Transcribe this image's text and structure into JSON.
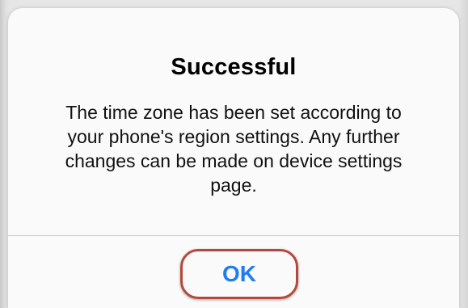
{
  "alert": {
    "title": "Successful",
    "message": "The time zone has been set according to your phone's region settings. Any further changes can be made on device settings page.",
    "ok_label": "OK"
  },
  "colors": {
    "button_text": "#1f7cf2",
    "highlight_ring": "#b5483c",
    "alert_background": "#fafafa"
  }
}
